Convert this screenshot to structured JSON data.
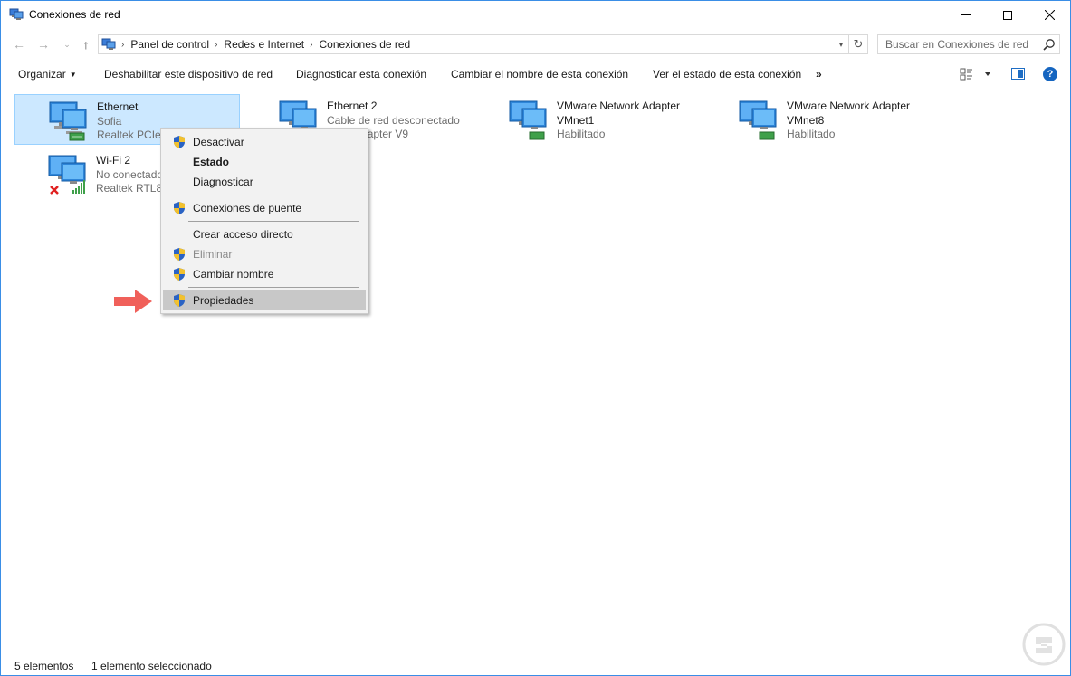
{
  "window": {
    "title": "Conexiones de red"
  },
  "address": {
    "breadcrumbs": [
      "Panel de control",
      "Redes e Internet",
      "Conexiones de red"
    ],
    "search_placeholder": "Buscar en Conexiones de red"
  },
  "toolbar": {
    "organizar": "Organizar",
    "deshabilitar": "Deshabilitar este dispositivo de red",
    "diagnosticar": "Diagnosticar esta conexión",
    "cambiar_nombre": "Cambiar el nombre de esta conexión",
    "ver_estado": "Ver el estado de esta conexión",
    "more": "»"
  },
  "connections": [
    {
      "name": "Ethernet",
      "line2": "Sofia",
      "line3": "Realtek PCIe G",
      "selected": true
    },
    {
      "name": "Ethernet 2",
      "line2": "Cable de red desconectado",
      "line3": "...ear Adapter V9"
    },
    {
      "name": "VMware Network Adapter",
      "line2": "VMnet1",
      "line3": "Habilitado"
    },
    {
      "name": "VMware Network Adapter",
      "line2": "VMnet8",
      "line3": "Habilitado"
    },
    {
      "name": "Wi-Fi 2",
      "line2": "No conectado",
      "line3": "Realtek RTL81"
    }
  ],
  "context_menu": {
    "items": [
      {
        "label": "Desactivar",
        "shield": true
      },
      {
        "label": "Estado",
        "bold": true
      },
      {
        "label": "Diagnosticar"
      },
      {
        "label": "Conexiones de puente",
        "shield": true
      },
      {
        "label": "Crear acceso directo"
      },
      {
        "label": "Eliminar",
        "shield": true,
        "disabled": true
      },
      {
        "label": "Cambiar nombre",
        "shield": true
      },
      {
        "label": "Propiedades",
        "shield": true,
        "highlighted": true
      }
    ]
  },
  "status": {
    "count": "5 elementos",
    "selection": "1 elemento seleccionado"
  },
  "colors": {
    "selection_bg": "#cce8ff",
    "accent": "#1565c0",
    "arrow": "#f0605a"
  }
}
